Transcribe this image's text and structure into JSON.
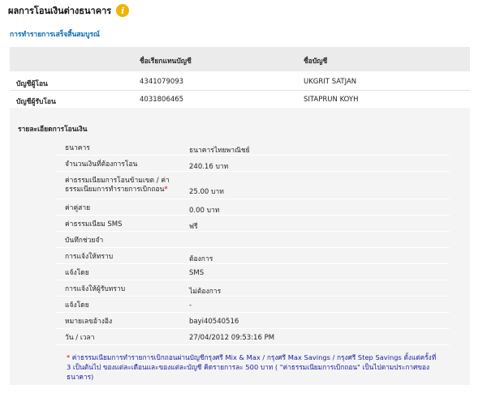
{
  "header": {
    "title": "ผลการโอนเงินต่างธนาคาร",
    "info_icon": "info-icon",
    "subtitle": "การทำรายการเสร็จสิ้นสมบูรณ์"
  },
  "accounts": {
    "col_nickname": "ชื่อเรียกแทนบัญชี",
    "col_name": "ชื่อบัญชี",
    "rows": [
      {
        "label": "บัญชีผู้โอน",
        "number": "4341079093",
        "name": "UKGRIT SATJAN"
      },
      {
        "label": "บัญชีผู้รับโอน",
        "number": "4031806465",
        "name": "SITAPRUN KOYH"
      }
    ]
  },
  "details": {
    "title": "รายละเอียดการโอนเงิน",
    "rows": [
      {
        "key": "ธนาคาร",
        "value": "ธนาคารไทยพาณิชย์"
      },
      {
        "key": "จำนวนเงินที่ต้องการโอน",
        "value": "240.16 บาท"
      },
      {
        "key": "ค่าธรรมเนียมการโอนข้ามเขต / ค่าธรรมเนียมการทำรายการเบิกถอน",
        "key_mark": "*",
        "value": "25.00 บาท"
      },
      {
        "key": "ค่าคู่สาย",
        "value": "0.00 บาท"
      },
      {
        "key": "ค่าธรรมเนียม SMS",
        "value": "ฟรี"
      },
      {
        "key": "บันทึกช่วยจำ",
        "value": ""
      },
      {
        "key": "การแจ้งให้ทราบ",
        "value": "ต้องการ"
      },
      {
        "key": "แจ้งโดย",
        "value": "SMS"
      },
      {
        "key": "การแจ้งให้ผู้รับทราบ",
        "value": "ไม่ต้องการ"
      },
      {
        "key": "แจ้งโดย",
        "value": "-"
      },
      {
        "key": "หมายเลขอ้างอิง",
        "value": "bayi40540516"
      },
      {
        "key": "วัน / เวลา",
        "value": "27/04/2012 09:53:16 PM"
      }
    ]
  },
  "footnote": {
    "mark": "*",
    "text": "ค่าธรรมเนียมการทำรายการเบิกถอนผ่านบัญชีกรุงศรี Mix & Max / กรุงศรี Max Savings / กรุงศรี Step Savings ตั้งแต่ครั้งที่ 3 เป็นต้นไป ของแต่ละเดือนและของแต่ละบัญชี คิดรายการละ 500 บาท ( \"ค่าธรรมเนียมการเบิกถอน\" เป็นไปตามประกาศของธนาคาร)"
  },
  "colors": {
    "link_blue": "#0068b0",
    "header_gray": "#ebebeb",
    "detail_bg": "#f4f4f4",
    "required_red": "#e00000",
    "footnote_blue": "#1a1aa6",
    "info_icon_yellow": "#f0b400"
  }
}
